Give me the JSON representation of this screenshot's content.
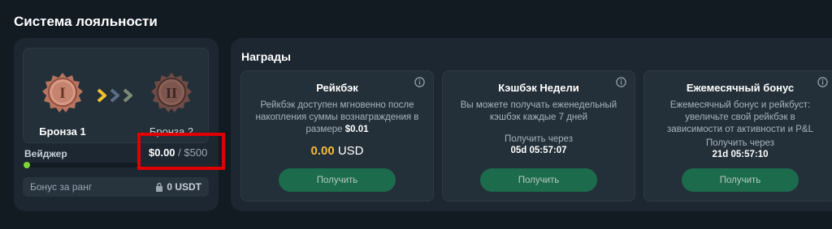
{
  "page": {
    "title": "Система лояльности"
  },
  "loyalty": {
    "current_level": "Бронза 1",
    "next_level": "Бронза 2",
    "current_badge_numeral": "I",
    "next_badge_numeral": "II",
    "wager_label": "Вейджер",
    "wager_current": "$0.00",
    "wager_separator": " / ",
    "wager_target": "$500",
    "wager_progress": 0,
    "rank_bonus_label": "Бонус за ранг",
    "rank_bonus_value": "0 USDT",
    "colors": {
      "bronze": "#c07f6b",
      "progress": "#7cd43a",
      "highlight": "#e00000"
    }
  },
  "rewards": {
    "title": "Награды",
    "cards": [
      {
        "title": "Рейкбэк",
        "desc_main": "Рейкбэк доступен мгновенно после накопления суммы вознаграждения в размере ",
        "desc_bold": "$0.01",
        "amount": "0.00",
        "currency": "USD",
        "button": "Получить"
      },
      {
        "title": "Кэшбэк Недели",
        "desc": "Вы можете получать еженедельный кэшбэк каждые 7 дней",
        "next_label": "Получить через",
        "next_time": "05d 05:57:07",
        "button": "Получить"
      },
      {
        "title": "Ежемесячный бонус",
        "desc": "Ежемесячный бонус и рейкбуст: увеличьте свой рейкбэк в зависимости от активности и P&L",
        "next_label": "Получить через",
        "next_time": "21d 05:57:10",
        "button": "Получить"
      }
    ],
    "colors": {
      "amount": "#f4b93c",
      "button": "#1c6b4d"
    }
  }
}
